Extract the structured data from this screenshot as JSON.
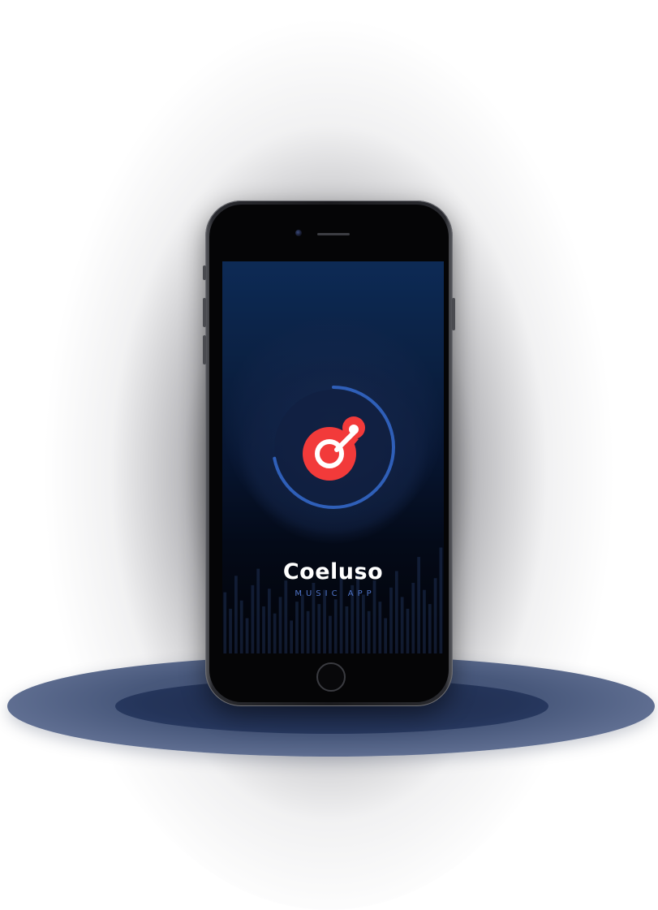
{
  "app": {
    "name": "Coeluso",
    "tagline": "MUSIC APP"
  },
  "splash": {
    "loading_progress": 0.72,
    "logo_icon": "coeluso-logo-icon",
    "progress_icon": "loading-ring-icon"
  },
  "colors": {
    "accent": "#f23a3a",
    "ring": "#2f5fb8",
    "tagline": "#4f74c8",
    "background_top": "#0d2a55",
    "background_bottom": "#020308"
  },
  "equalizer": {
    "levels": [
      0.52,
      0.38,
      0.66,
      0.45,
      0.3,
      0.58,
      0.72,
      0.4,
      0.55,
      0.34,
      0.48,
      0.62,
      0.28,
      0.44,
      0.5,
      0.36,
      0.6,
      0.42,
      0.54,
      0.32,
      0.46,
      0.66,
      0.4,
      0.58,
      0.74,
      0.5,
      0.36,
      0.62,
      0.44,
      0.3,
      0.56,
      0.7,
      0.48,
      0.38,
      0.6,
      0.82,
      0.54,
      0.42,
      0.64,
      0.9
    ]
  }
}
